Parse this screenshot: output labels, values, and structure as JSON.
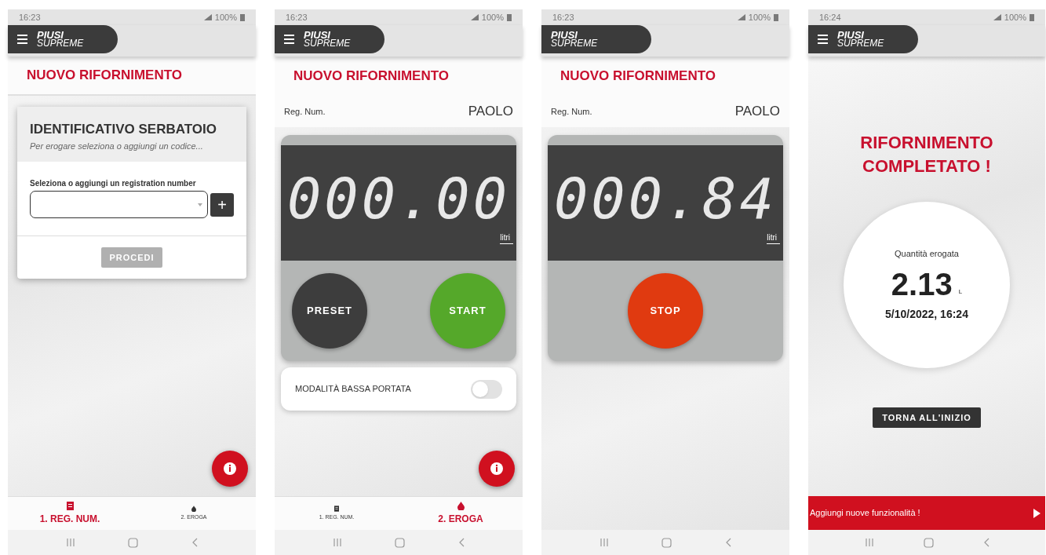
{
  "screens": [
    {
      "status": {
        "time": "16:23",
        "battery": "100%"
      },
      "menu_button": true,
      "logo": [
        "PIUSI",
        "SUPREME"
      ],
      "title": "NUOVO RIFORNIMENTO",
      "card": {
        "title": "IDENTIFICATIVO SERBATOIO",
        "subtitle": "Per erogare seleziona o aggiungi un codice...",
        "field_label": "Seleziona o aggiungi un registration number",
        "add_button": "+",
        "button": "PROCEDI",
        "disabled": true
      },
      "fab": true,
      "bottom_nav": [
        {
          "label": "1. REG. NUM.",
          "kind": "form",
          "selected": true
        },
        {
          "label": "2. EROGA",
          "kind": "drop",
          "selected": false
        }
      ]
    },
    {
      "status": {
        "time": "16:23",
        "battery": "100%"
      },
      "menu_button": true,
      "logo": [
        "PIUSI",
        "SUPREME"
      ],
      "title": "NUOVO RIFORNIMENTO",
      "reg": {
        "label": "Reg. Num.",
        "value": "PAOLO"
      },
      "display": {
        "reading": "000.00",
        "unit": "litri"
      },
      "controls": [
        {
          "label": "PRESET",
          "kind": "preset"
        },
        {
          "label": "START",
          "kind": "start"
        }
      ],
      "toggle": {
        "label": "MODALITÀ BASSA PORTATA",
        "on": false
      },
      "fab": true,
      "bottom_nav": [
        {
          "label": "1. REG. NUM.",
          "kind": "form",
          "selected": false
        },
        {
          "label": "2. EROGA",
          "kind": "drop",
          "selected": true
        }
      ]
    },
    {
      "status": {
        "time": "16:23",
        "battery": "100%"
      },
      "menu_button": false,
      "logo": [
        "PIUSI",
        "SUPREME"
      ],
      "title": "NUOVO RIFORNIMENTO",
      "reg": {
        "label": "Reg. Num.",
        "value": "PAOLO"
      },
      "display": {
        "reading": "000.84",
        "unit": "litri"
      },
      "controls": [
        {
          "label": "STOP",
          "kind": "stop"
        }
      ],
      "fab": false
    },
    {
      "status": {
        "time": "16:24",
        "battery": "100%"
      },
      "menu_button": true,
      "logo": [
        "PIUSI",
        "SUPREME"
      ],
      "result": {
        "title": "RIFORNIMENTO COMPLETATO !",
        "quantity_label": "Quantità erogata",
        "quantity": "2.13",
        "unit": "L",
        "datetime": "5/10/2022, 16:24",
        "button": "TORNA ALL'INIZIO"
      },
      "fab": false,
      "banner": "Aggiungi nuove funzionalità !"
    }
  ]
}
